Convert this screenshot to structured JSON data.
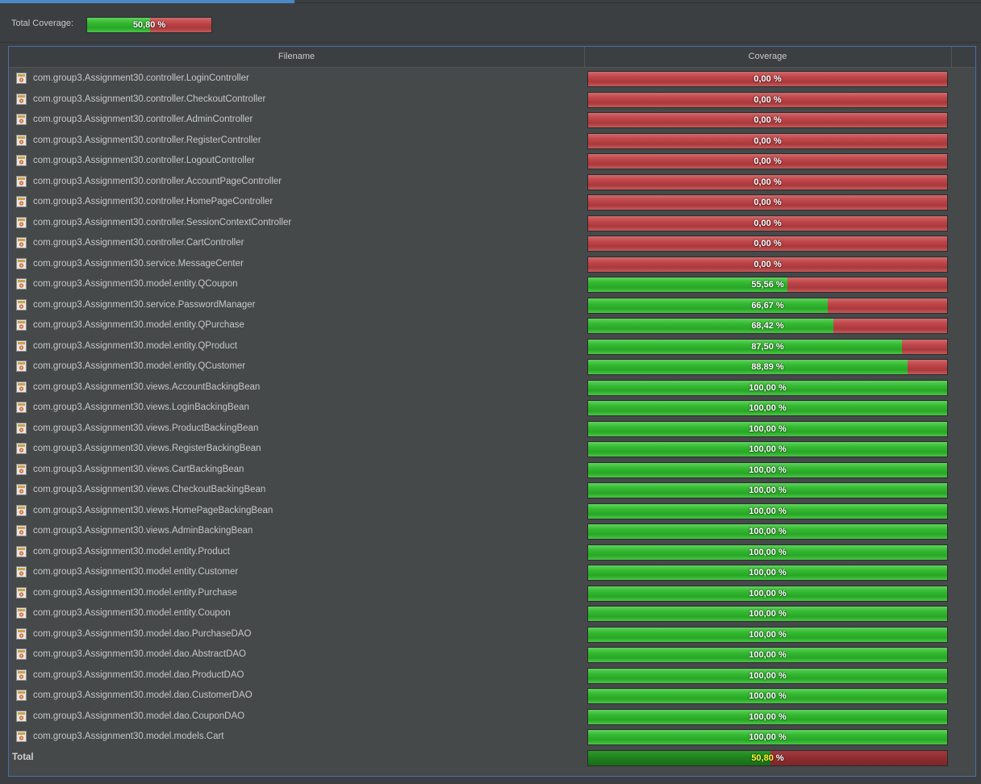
{
  "summary": {
    "label": "Total Coverage:",
    "coverage": 50.8,
    "text": "50,80",
    "unit": "%"
  },
  "table": {
    "columns": [
      "Filename",
      "Coverage"
    ],
    "rows": [
      {
        "name": "com.group3.Assignment30.controller.LoginController",
        "coverage": 0.0,
        "text": "0,00",
        "unit": "%"
      },
      {
        "name": "com.group3.Assignment30.controller.CheckoutController",
        "coverage": 0.0,
        "text": "0,00",
        "unit": "%"
      },
      {
        "name": "com.group3.Assignment30.controller.AdminController",
        "coverage": 0.0,
        "text": "0,00",
        "unit": "%"
      },
      {
        "name": "com.group3.Assignment30.controller.RegisterController",
        "coverage": 0.0,
        "text": "0,00",
        "unit": "%"
      },
      {
        "name": "com.group3.Assignment30.controller.LogoutController",
        "coverage": 0.0,
        "text": "0,00",
        "unit": "%"
      },
      {
        "name": "com.group3.Assignment30.controller.AccountPageController",
        "coverage": 0.0,
        "text": "0,00",
        "unit": "%"
      },
      {
        "name": "com.group3.Assignment30.controller.HomePageController",
        "coverage": 0.0,
        "text": "0,00",
        "unit": "%"
      },
      {
        "name": "com.group3.Assignment30.controller.SessionContextController",
        "coverage": 0.0,
        "text": "0,00",
        "unit": "%"
      },
      {
        "name": "com.group3.Assignment30.controller.CartController",
        "coverage": 0.0,
        "text": "0,00",
        "unit": "%"
      },
      {
        "name": "com.group3.Assignment30.service.MessageCenter",
        "coverage": 0.0,
        "text": "0,00",
        "unit": "%"
      },
      {
        "name": "com.group3.Assignment30.model.entity.QCoupon",
        "coverage": 55.56,
        "text": "55,56",
        "unit": "%"
      },
      {
        "name": "com.group3.Assignment30.service.PasswordManager",
        "coverage": 66.67,
        "text": "66,67",
        "unit": "%"
      },
      {
        "name": "com.group3.Assignment30.model.entity.QPurchase",
        "coverage": 68.42,
        "text": "68,42",
        "unit": "%"
      },
      {
        "name": "com.group3.Assignment30.model.entity.QProduct",
        "coverage": 87.5,
        "text": "87,50",
        "unit": "%"
      },
      {
        "name": "com.group3.Assignment30.model.entity.QCustomer",
        "coverage": 88.89,
        "text": "88,89",
        "unit": "%"
      },
      {
        "name": "com.group3.Assignment30.views.AccountBackingBean",
        "coverage": 100,
        "text": "100,00",
        "unit": "%"
      },
      {
        "name": "com.group3.Assignment30.views.LoginBackingBean",
        "coverage": 100,
        "text": "100,00",
        "unit": "%"
      },
      {
        "name": "com.group3.Assignment30.views.ProductBackingBean",
        "coverage": 100,
        "text": "100,00",
        "unit": "%"
      },
      {
        "name": "com.group3.Assignment30.views.RegisterBackingBean",
        "coverage": 100,
        "text": "100,00",
        "unit": "%"
      },
      {
        "name": "com.group3.Assignment30.views.CartBackingBean",
        "coverage": 100,
        "text": "100,00",
        "unit": "%"
      },
      {
        "name": "com.group3.Assignment30.views.CheckoutBackingBean",
        "coverage": 100,
        "text": "100,00",
        "unit": "%"
      },
      {
        "name": "com.group3.Assignment30.views.HomePageBackingBean",
        "coverage": 100,
        "text": "100,00",
        "unit": "%"
      },
      {
        "name": "com.group3.Assignment30.views.AdminBackingBean",
        "coverage": 100,
        "text": "100,00",
        "unit": "%"
      },
      {
        "name": "com.group3.Assignment30.model.entity.Product",
        "coverage": 100,
        "text": "100,00",
        "unit": "%"
      },
      {
        "name": "com.group3.Assignment30.model.entity.Customer",
        "coverage": 100,
        "text": "100,00",
        "unit": "%"
      },
      {
        "name": "com.group3.Assignment30.model.entity.Purchase",
        "coverage": 100,
        "text": "100,00",
        "unit": "%"
      },
      {
        "name": "com.group3.Assignment30.model.entity.Coupon",
        "coverage": 100,
        "text": "100,00",
        "unit": "%"
      },
      {
        "name": "com.group3.Assignment30.model.dao.PurchaseDAO",
        "coverage": 100,
        "text": "100,00",
        "unit": "%"
      },
      {
        "name": "com.group3.Assignment30.model.dao.AbstractDAO",
        "coverage": 100,
        "text": "100,00",
        "unit": "%"
      },
      {
        "name": "com.group3.Assignment30.model.dao.ProductDAO",
        "coverage": 100,
        "text": "100,00",
        "unit": "%"
      },
      {
        "name": "com.group3.Assignment30.model.dao.CustomerDAO",
        "coverage": 100,
        "text": "100,00",
        "unit": "%"
      },
      {
        "name": "com.group3.Assignment30.model.dao.CouponDAO",
        "coverage": 100,
        "text": "100,00",
        "unit": "%"
      },
      {
        "name": "com.group3.Assignment30.model.models.Cart",
        "coverage": 100,
        "text": "100,00",
        "unit": "%"
      }
    ],
    "total": {
      "label": "Total",
      "coverage": 50.8,
      "text": "50,80",
      "unit": "%"
    }
  },
  "colors": {
    "background": "#3c3f41",
    "table_background": "#45494a",
    "covered": "#35b932",
    "uncovered": "#c0464a",
    "selection_accent": "#4a88c7",
    "total_value": "#ffff33"
  },
  "icons": {
    "file": "java-file-icon"
  }
}
